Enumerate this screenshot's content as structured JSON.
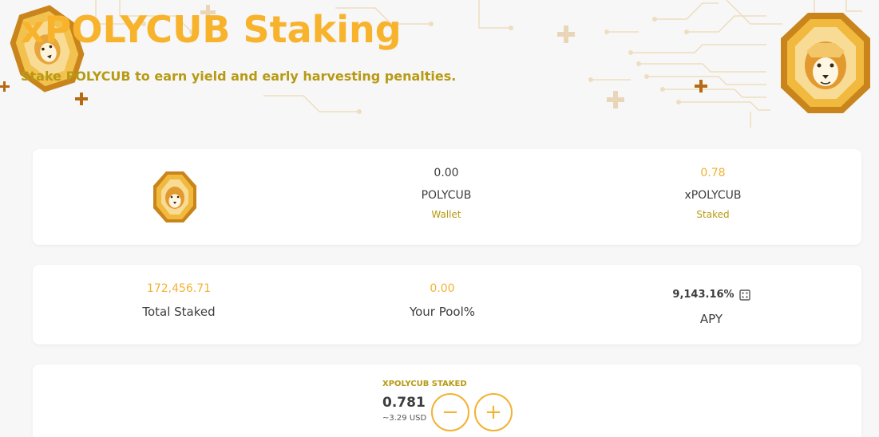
{
  "header": {
    "title": "xPOLYCUB Staking",
    "subtitle": "Stake POLYCUB to earn yield and early harvesting penalties.",
    "logo_icon": "lion-coin-icon"
  },
  "balances": {
    "wallet": {
      "amount": "0.00",
      "token": "POLYCUB",
      "label": "Wallet"
    },
    "staked": {
      "amount": "0.78",
      "token": "xPOLYCUB",
      "label": "Staked"
    }
  },
  "stats": {
    "total_staked": {
      "value": "172,456.71",
      "label": "Total Staked"
    },
    "your_pool": {
      "value": "0.00",
      "label": "Your Pool%"
    },
    "apy": {
      "value": "9,143.16%",
      "label": "APY",
      "icon": "calculator-icon"
    }
  },
  "staked_control": {
    "heading": "XPOLYCUB STAKED",
    "amount": "0.781",
    "usd": "~3.29 USD",
    "minus_label": "−",
    "plus_label": "+"
  },
  "colors": {
    "accent": "#f2b233",
    "accent_dark": "#b79a13",
    "text": "#3d3d3d",
    "background": "#f7f7f7"
  }
}
